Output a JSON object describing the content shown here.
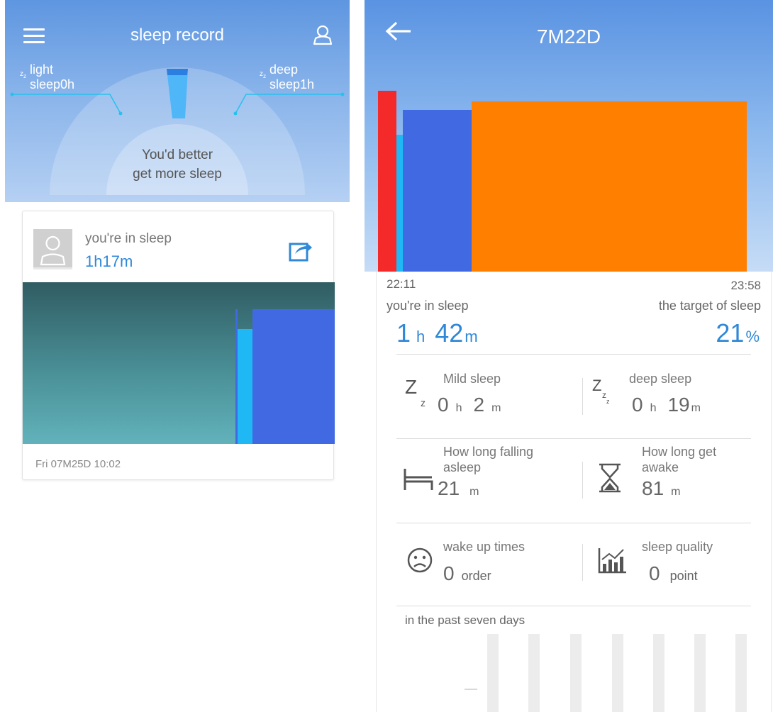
{
  "left": {
    "title": "sleep record",
    "light_label": "light\nsleep0h",
    "deep_label": "deep\nsleep1h",
    "dial_message_1": "You'd better",
    "dial_message_2": "get more sleep",
    "card": {
      "label": "you're in sleep",
      "value": "1h17m",
      "date": "Fri 07M25D 10:02"
    }
  },
  "right": {
    "title": "7M22D",
    "time_start": "22:11",
    "time_end": "23:58",
    "sleep_label": "you're in sleep",
    "sleep_hours": "1",
    "sleep_hours_unit": "h",
    "sleep_minutes": "42",
    "sleep_minutes_unit": "m",
    "target_label": "the target of sleep",
    "target_value": "21",
    "target_unit": "%",
    "stats": {
      "mild_label": "Mild sleep",
      "mild_h": "0",
      "mild_h_unit": "h",
      "mild_m": "2",
      "mild_m_unit": "m",
      "deep_label": "deep sleep",
      "deep_h": "0",
      "deep_h_unit": "h",
      "deep_m": "19",
      "deep_m_unit": "m",
      "falling_label_1": "How long falling",
      "falling_label_2": "asleep",
      "falling_value": "21",
      "falling_unit": "m",
      "awake_label_1": "How long get",
      "awake_label_2": "awake",
      "awake_value": "81",
      "awake_unit": "m",
      "wake_label": "wake up times",
      "wake_value": "0",
      "wake_unit": "order",
      "quality_label": "sleep quality",
      "quality_value": "0",
      "quality_unit": "point"
    },
    "week_label": "in the past seven days"
  },
  "colors": {
    "accent_blue": "#2f88d8",
    "deep_bar": "#4169e1",
    "light_bar": "#1fb8f5",
    "awake_bar": "#ff7f00",
    "red_bar": "#f42a2a"
  },
  "icons": [
    "menu-icon",
    "user-icon",
    "share-icon",
    "back-icon",
    "zz-icon",
    "bed-icon",
    "hourglass-icon",
    "sad-face-icon",
    "chart-icon"
  ]
}
